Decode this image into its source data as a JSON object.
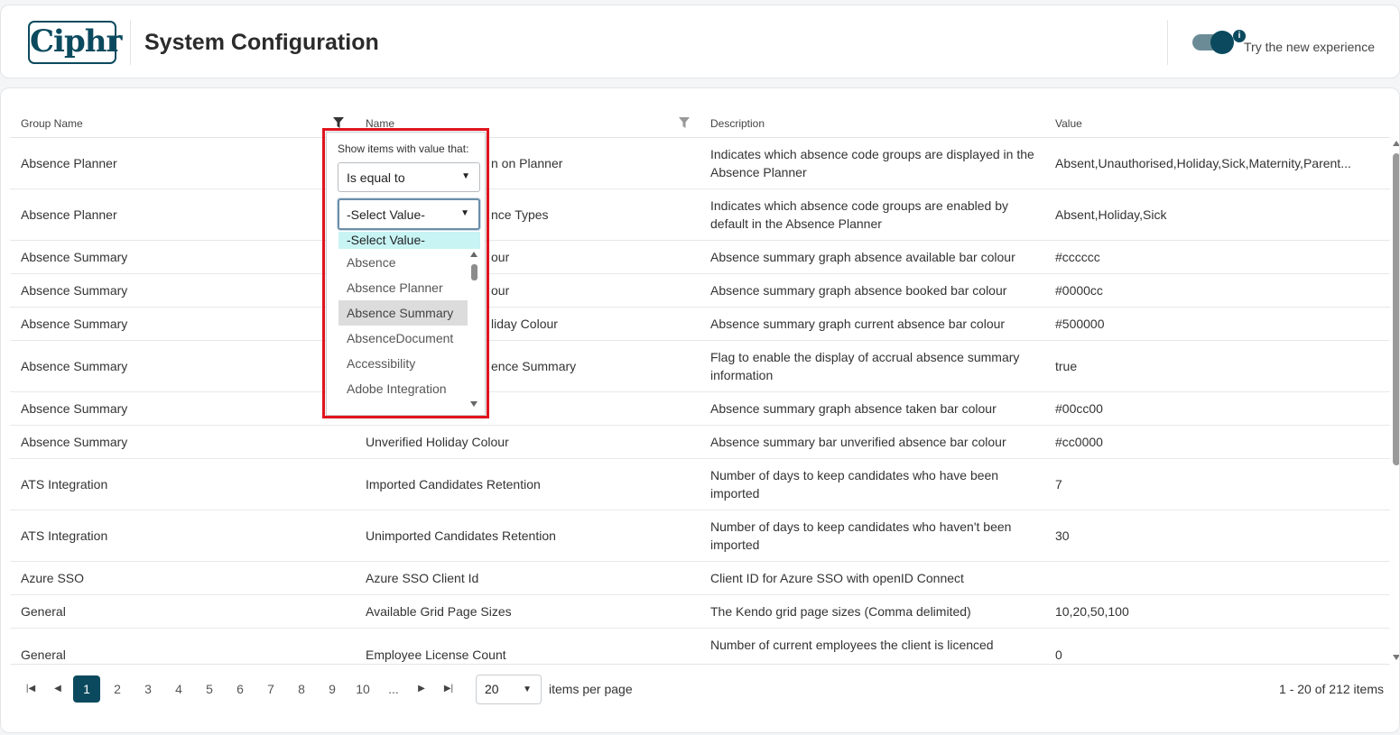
{
  "header": {
    "logo_text": "Ciphr",
    "title": "System Configuration",
    "toggle_label": "Try the new experience",
    "info_icon": "i"
  },
  "table": {
    "columns": [
      "Group Name",
      "Name",
      "Description",
      "Value"
    ],
    "rows": [
      {
        "group": "Absence Planner",
        "name": "n on Planner",
        "description": "Indicates which absence code groups are displayed in the Absence Planner",
        "value": "Absent,Unauthorised,Holiday,Sick,Maternity,Parent..."
      },
      {
        "group": "Absence Planner",
        "name": "nce Types",
        "description": "Indicates which absence code groups are enabled by default in the Absence Planner",
        "value": "Absent,Holiday,Sick"
      },
      {
        "group": "Absence Summary",
        "name": "our",
        "description": "Absence summary graph absence available bar colour",
        "value": "#cccccc"
      },
      {
        "group": "Absence Summary",
        "name": "our",
        "description": "Absence summary graph absence booked bar colour",
        "value": "#0000cc"
      },
      {
        "group": "Absence Summary",
        "name": "liday Colour",
        "description": "Absence summary graph current absence bar colour",
        "value": "#500000"
      },
      {
        "group": "Absence Summary",
        "name": "ence Summary",
        "description": "Flag to enable the display of accrual absence summary information",
        "value": "true"
      },
      {
        "group": "Absence Summary",
        "name": "",
        "description": "Absence summary graph absence taken bar colour",
        "value": "#00cc00"
      },
      {
        "group": "Absence Summary",
        "name": "Unverified Holiday Colour",
        "description": "Absence summary bar unverified absence bar colour",
        "value": "#cc0000"
      },
      {
        "group": "ATS Integration",
        "name": "Imported Candidates Retention",
        "description": "Number of days to keep candidates who have been imported",
        "value": "7"
      },
      {
        "group": "ATS Integration",
        "name": "Unimported Candidates Retention",
        "description": "Number of days to keep candidates who haven't been imported",
        "value": "30"
      },
      {
        "group": "Azure SSO",
        "name": "Azure SSO Client Id",
        "description": "Client ID for Azure SSO with openID Connect",
        "value": ""
      },
      {
        "group": "General",
        "name": "Available Grid Page Sizes",
        "description": "The Kendo grid page sizes (Comma delimited)",
        "value": "10,20,50,100"
      },
      {
        "group": "General",
        "name": "Employee License Count",
        "description": "Number of current employees the client is licenced",
        "value": "0"
      }
    ]
  },
  "filter_popup": {
    "label": "Show items with value that:",
    "operator": "Is equal to",
    "value": "-Select Value-",
    "options": [
      "-Select Value-",
      "Absence",
      "Absence Planner",
      "Absence Summary",
      "AbsenceDocument",
      "Accessibility",
      "Adobe Integration"
    ],
    "hovered_option": "Absence Summary"
  },
  "pager": {
    "pages": [
      "1",
      "2",
      "3",
      "4",
      "5",
      "6",
      "7",
      "8",
      "9",
      "10",
      "..."
    ],
    "current_page": "1",
    "page_size": "20",
    "items_per_page_label": "items per page",
    "count_label": "1 - 20 of 212 items"
  },
  "colors": {
    "brand": "#0b4a5e",
    "highlight_frame": "#e0141e",
    "selected_option_bg": "#c8f4f4"
  }
}
